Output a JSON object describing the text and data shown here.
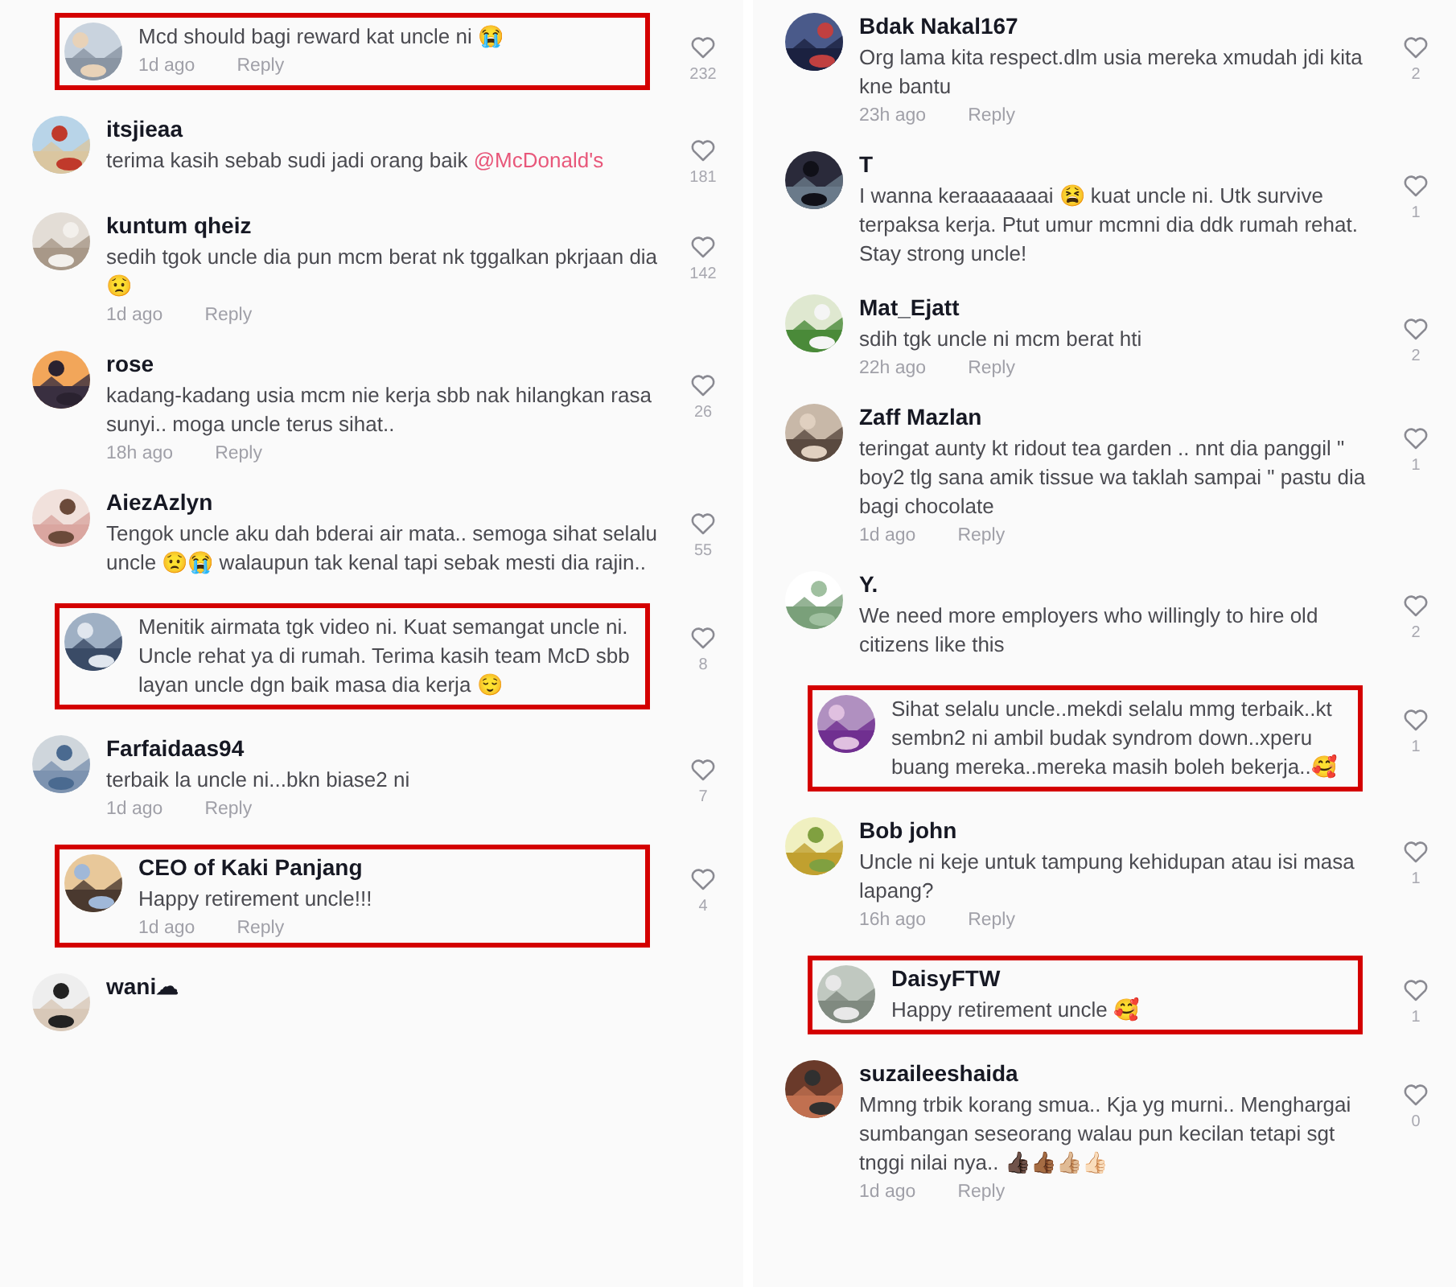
{
  "columns": [
    {
      "comments": [
        {
          "text": "Mcd should bagi reward kat uncle ni 😭",
          "time": "1d ago",
          "reply": "Reply",
          "likes": "232",
          "highlighted": true
        },
        {
          "username": "itsjieaa",
          "text": "terima kasih sebab sudi jadi orang baik ",
          "mention": "@McDonald's",
          "likes": "181",
          "highlighted": false
        },
        {
          "username": "kuntum qheiz",
          "text": "sedih tgok uncle dia pun mcm berat nk tggalkan pkrjaan dia😟",
          "time": "1d ago",
          "reply": "Reply",
          "likes": "142",
          "highlighted": false
        },
        {
          "username": "rose",
          "text": "kadang-kadang usia mcm nie kerja sbb nak hilangkan rasa sunyi.. moga uncle terus sihat..",
          "time": "18h ago",
          "reply": "Reply",
          "likes": "26",
          "highlighted": false
        },
        {
          "username": "AiezAzlyn",
          "text": "Tengok uncle aku dah bderai air mata.. semoga sihat selalu uncle 😟😭 walaupun tak kenal tapi sebak mesti dia rajin..",
          "likes": "55",
          "highlighted": false
        },
        {
          "text": "Menitik airmata tgk video ni. Kuat semangat uncle ni. Uncle rehat ya di rumah. Terima kasih team McD sbb layan uncle dgn baik masa dia kerja 😌",
          "likes": "8",
          "highlighted": true
        },
        {
          "username": "Farfaidaas94",
          "text": "terbaik la uncle ni...bkn biase2 ni",
          "time": "1d ago",
          "reply": "Reply",
          "likes": "7",
          "highlighted": false
        },
        {
          "username": "CEO of Kaki Panjang",
          "text": "Happy retirement uncle!!!",
          "time": "1d ago",
          "reply": "Reply",
          "likes": "4",
          "highlighted": true
        },
        {
          "username": "wani☁",
          "highlighted": false
        }
      ]
    },
    {
      "comments": [
        {
          "username": "Bdak Nakal167",
          "text": "Org lama kita respect.dlm usia mereka xmudah jdi kita kne bantu",
          "time": "23h ago",
          "reply": "Reply",
          "likes": "2",
          "highlighted": false
        },
        {
          "username": "T",
          "text": "I wanna keraaaaaaai 😫 kuat uncle ni. Utk survive terpaksa kerja. Ptut umur mcmni dia ddk rumah rehat. Stay strong uncle!",
          "likes": "1",
          "highlighted": false
        },
        {
          "username": "Mat_Ejatt",
          "text": "sdih tgk uncle ni mcm berat hti",
          "time": "22h ago",
          "reply": "Reply",
          "likes": "2",
          "highlighted": false
        },
        {
          "username": "Zaff Mazlan",
          "text": "teringat aunty kt ridout tea garden .. nnt dia panggil \" boy2 tlg sana amik tissue wa taklah sampai \" pastu dia bagi chocolate",
          "time": "1d ago",
          "reply": "Reply",
          "likes": "1",
          "highlighted": false
        },
        {
          "username": "Y.",
          "text": "We need more employers who willingly to hire old citizens like this",
          "likes": "2",
          "highlighted": false
        },
        {
          "text": "Sihat selalu uncle..mekdi selalu mmg terbaik..kt sembn2 ni ambil budak syndrom down..xperu buang mereka..mereka masih boleh bekerja..🥰",
          "likes": "1",
          "highlighted": true
        },
        {
          "username": "Bob john",
          "text": "Uncle ni keje untuk tampung kehidupan atau isi masa lapang?",
          "time": "16h ago",
          "reply": "Reply",
          "likes": "1",
          "highlighted": false
        },
        {
          "username": "DaisyFTW",
          "text": "Happy retirement uncle 🥰",
          "likes": "1",
          "highlighted": true
        },
        {
          "username": "suzaileeshaida",
          "text": "Mmng trbik korang smua.. Kja yg murni.. Menghargai sumbangan seseorang walau pun kecilan tetapi sgt tnggi nilai nya.. 👍🏿👍🏾👍🏼👍🏻",
          "time": "1d ago",
          "reply": "Reply",
          "likes": "0",
          "highlighted": false
        }
      ]
    }
  ]
}
